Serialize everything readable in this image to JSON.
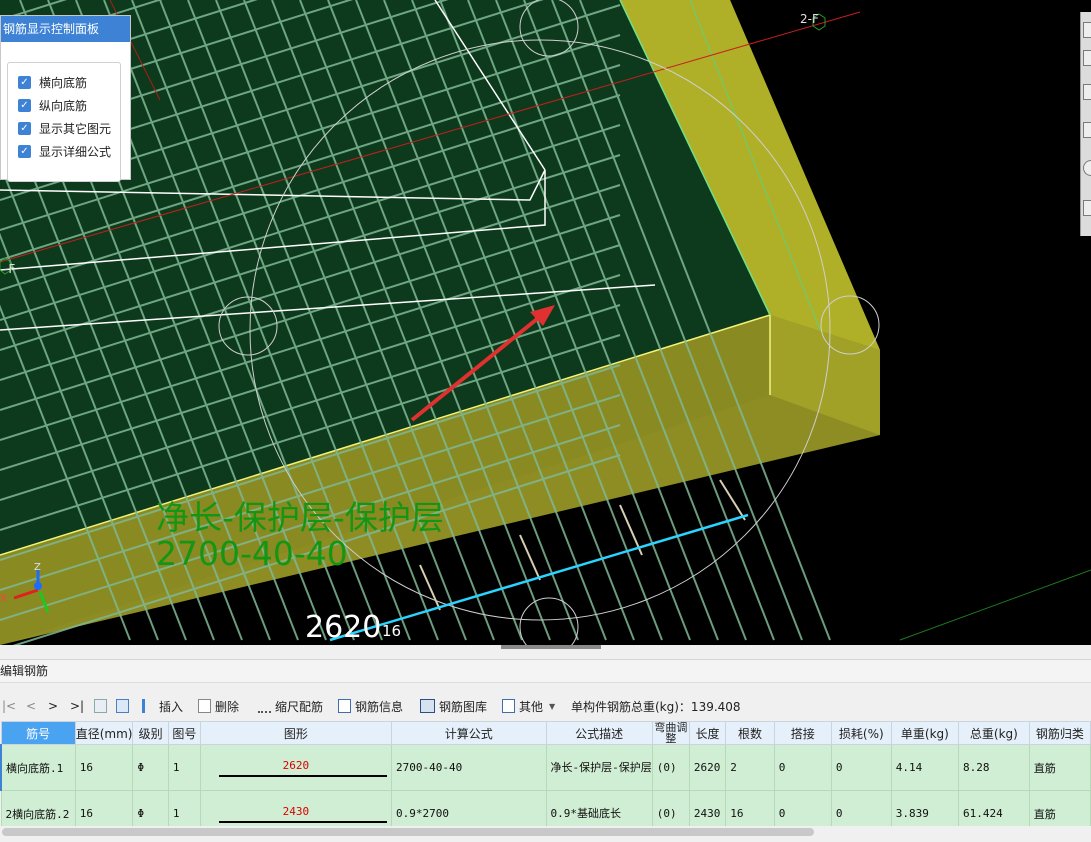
{
  "control_panel": {
    "title": "钢筋显示控制面板",
    "options": [
      {
        "label": "横向底筋",
        "checked": true
      },
      {
        "label": "纵向底筋",
        "checked": true
      },
      {
        "label": "显示其它图元",
        "checked": true
      },
      {
        "label": "显示详细公式",
        "checked": true
      }
    ]
  },
  "viewport": {
    "axis_label_top": "2-F",
    "axis_label_left": "-F",
    "formula_text": "净长-保护层-保护层",
    "formula_values": "2700-40-40",
    "dimension_value": "2620",
    "dimension_suffix": "16",
    "axis_x": "X",
    "axis_z": "Z"
  },
  "panel": {
    "title": "编辑钢筋"
  },
  "toolbar": {
    "nav": [
      "|<",
      "<",
      ">",
      ">|"
    ],
    "insert": "插入",
    "delete": "删除",
    "scale_rebar": "缩尺配筋",
    "rebar_info": "钢筋信息",
    "rebar_library": "钢筋图库",
    "other": "其他",
    "total_weight": "单构件钢筋总重(kg)：139.408"
  },
  "table": {
    "headers": [
      "筋号",
      "直径(mm)",
      "级别",
      "图号",
      "图形",
      "计算公式",
      "公式描述",
      "弯曲调整",
      "长度",
      "根数",
      "搭接",
      "损耗(%)",
      "单重(kg)",
      "总重(kg)",
      "钢筋归类"
    ],
    "rows": [
      {
        "marker": "",
        "name": "横向底筋.1",
        "diameter": "16",
        "grade": "Φ",
        "figure": "1",
        "shape_value": "2620",
        "formula": "2700-40-40",
        "description": "净长-保护层-保护层",
        "bend": "(0)",
        "length": "2620",
        "count": "2",
        "lap": "0",
        "loss": "0",
        "unit_weight": "4.14",
        "total_weight": "8.28",
        "category": "直筋"
      },
      {
        "marker": "2",
        "name": "横向底筋.2",
        "diameter": "16",
        "grade": "Φ",
        "figure": "1",
        "shape_value": "2430",
        "formula": "0.9*2700",
        "description": "0.9*基础底长",
        "bend": "(0)",
        "length": "2430",
        "count": "16",
        "lap": "0",
        "loss": "0",
        "unit_weight": "3.839",
        "total_weight": "61.424",
        "category": "直筋"
      }
    ]
  },
  "colors": {
    "accent": "#3d82d5",
    "row_bg": "#cfeed3",
    "formula_text": "#149614",
    "slab": "#0d3a1c",
    "concrete_edge": "#c8c832"
  }
}
